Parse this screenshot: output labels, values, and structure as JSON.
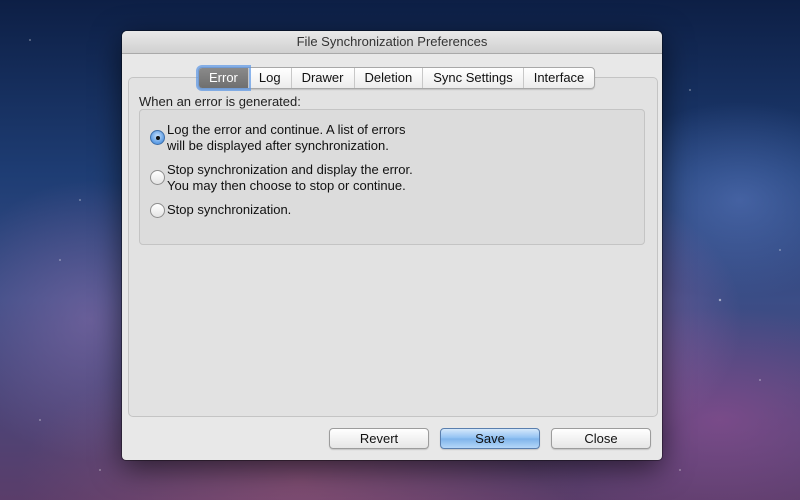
{
  "window": {
    "title": "File Synchronization Preferences"
  },
  "tabs": [
    {
      "label": "Error",
      "active": true
    },
    {
      "label": "Log",
      "active": false
    },
    {
      "label": "Drawer",
      "active": false
    },
    {
      "label": "Deletion",
      "active": false
    },
    {
      "label": "Sync Settings",
      "active": false
    },
    {
      "label": "Interface",
      "active": false
    }
  ],
  "error_tab": {
    "group_label": "When an error is generated:",
    "options": [
      {
        "line1": "Log the error and continue. A list of errors",
        "line2": "will be displayed after synchronization.",
        "selected": true
      },
      {
        "line1": "Stop synchronization and display the error.",
        "line2": "You may then choose to stop or continue.",
        "selected": false
      },
      {
        "line1": "Stop synchronization.",
        "line2": "",
        "selected": false
      }
    ]
  },
  "buttons": {
    "revert": "Revert",
    "save": "Save",
    "close": "Close"
  }
}
